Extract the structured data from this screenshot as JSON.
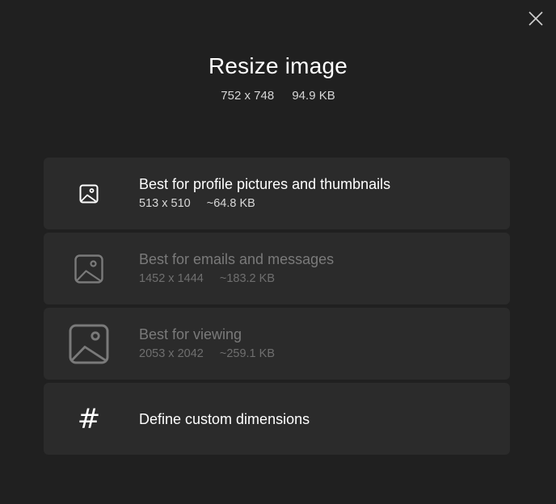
{
  "dialog": {
    "title": "Resize image",
    "dimensions": "752 x 748",
    "size": "94.9 KB",
    "close_icon": "close-icon"
  },
  "options": [
    {
      "title": "Best for profile pictures and thumbnails",
      "dimensions": "513 x 510",
      "size": "~64.8 KB",
      "icon": "image-icon",
      "enabled": true
    },
    {
      "title": "Best for emails and messages",
      "dimensions": "1452 x 1444",
      "size": "~183.2 KB",
      "icon": "image-icon",
      "enabled": false
    },
    {
      "title": "Best for viewing",
      "dimensions": "2053 x 2042",
      "size": "~259.1 KB",
      "icon": "image-icon",
      "enabled": false
    },
    {
      "title": "Define custom dimensions",
      "icon": "hash-icon",
      "icon_glyph": "#",
      "enabled": true
    }
  ],
  "colors": {
    "background": "#202020",
    "card": "#2b2b2b",
    "text": "#ffffff",
    "disabled_text": "#7a7a7a"
  }
}
